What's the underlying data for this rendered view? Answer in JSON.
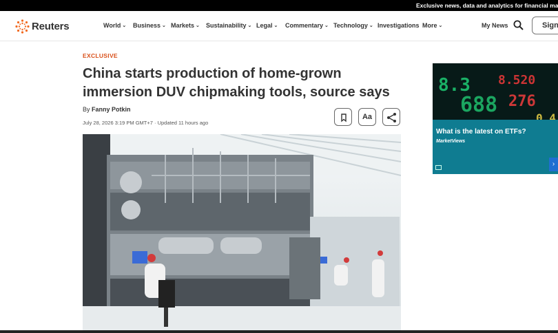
{
  "topbar": {
    "promo": "Exclusive news, data and analytics for financial mar"
  },
  "header": {
    "logo_text": "Reuters",
    "nav": [
      {
        "label": "World"
      },
      {
        "label": "Business"
      },
      {
        "label": "Markets"
      },
      {
        "label": "Sustainability"
      },
      {
        "label": "Legal"
      },
      {
        "label": "Commentary"
      },
      {
        "label": "Technology"
      },
      {
        "label": "Investigations"
      },
      {
        "label": "More"
      }
    ],
    "my_news": "My News",
    "sign_in": "Sign"
  },
  "article": {
    "kicker": "EXCLUSIVE",
    "headline": "China starts production of home-grown immersion DUV chipmaking tools, source says",
    "byline_prefix": "By",
    "author": "Fanny Potkin",
    "dateline": "July 28, 2026 3:19 PM GMT+7 · Updated 11 hours ago",
    "font_button": "Aa"
  },
  "ad": {
    "title": "What is the latest on ETFs?",
    "source": "MarketViews"
  },
  "icons": {
    "logo": "reuters-dots-logo",
    "search": "search-icon",
    "bookmark": "bookmark-icon",
    "share": "share-icon"
  },
  "colors": {
    "accent": "#d9501a",
    "ad_bg": "#0f7c91"
  }
}
